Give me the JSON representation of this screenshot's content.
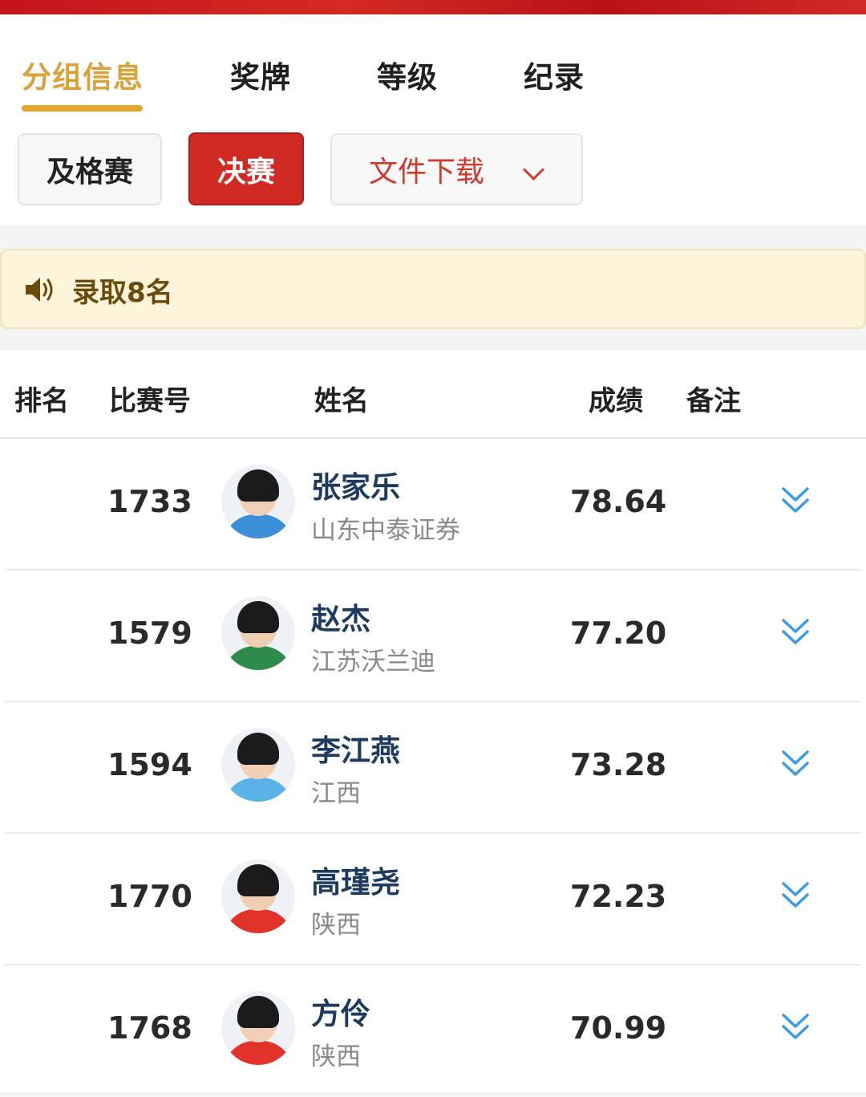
{
  "tabs": [
    {
      "label": "分组信息",
      "active": true
    },
    {
      "label": "奖牌",
      "active": false
    },
    {
      "label": "等级",
      "active": false
    },
    {
      "label": "纪录",
      "active": false
    }
  ],
  "filters": {
    "qualification_label": "及格赛",
    "final_label": "决赛",
    "download_label": "文件下载"
  },
  "notice": {
    "icon": "speaker-icon",
    "text": "录取8名"
  },
  "table": {
    "headers": {
      "rank": "排名",
      "bib": "比赛号",
      "name": "姓名",
      "result": "成绩",
      "note": "备注"
    },
    "rows": [
      {
        "bib": "1733",
        "name": "张家乐",
        "team": "山东中泰证券",
        "result": "78.64",
        "jersey_color": "#3b8fd9"
      },
      {
        "bib": "1579",
        "name": "赵杰",
        "team": "江苏沃兰迪",
        "result": "77.20",
        "jersey_color": "#2e8b4a"
      },
      {
        "bib": "1594",
        "name": "李江燕",
        "team": "江西",
        "result": "73.28",
        "jersey_color": "#5ab3e6"
      },
      {
        "bib": "1770",
        "name": "高瑾尧",
        "team": "陕西",
        "result": "72.23",
        "jersey_color": "#e2332b"
      },
      {
        "bib": "1768",
        "name": "方伶",
        "team": "陕西",
        "result": "70.99",
        "jersey_color": "#e2332b"
      }
    ]
  },
  "colors": {
    "accent_gold": "#e3a52c",
    "brand_red": "#d12a24",
    "name_blue": "#1c3b5e",
    "expand_blue": "#3a9be6"
  }
}
